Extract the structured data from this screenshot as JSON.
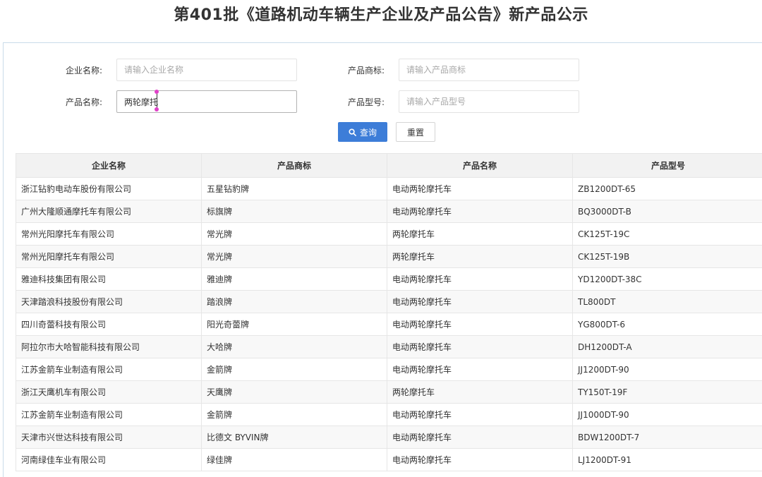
{
  "page": {
    "title": "第401批《道路机动车辆生产企业及产品公告》新产品公示"
  },
  "form": {
    "company_label": "企业名称:",
    "company_placeholder": "请输入企业名称",
    "company_value": "",
    "brand_label": "产品商标:",
    "brand_placeholder": "请输入产品商标",
    "brand_value": "",
    "product_label": "产品名称:",
    "product_placeholder": "",
    "product_value": "两轮摩托",
    "model_label": "产品型号:",
    "model_placeholder": "请输入产品型号",
    "model_value": "",
    "search_label": "查询",
    "reset_label": "重置"
  },
  "table": {
    "headers": [
      "企业名称",
      "产品商标",
      "产品名称",
      "产品型号"
    ],
    "rows": [
      [
        "浙江钻豹电动车股份有限公司",
        "五星钻豹牌",
        "电动两轮摩托车",
        "ZB1200DT-65"
      ],
      [
        "广州大隆顺通摩托车有限公司",
        "标旗牌",
        "电动两轮摩托车",
        "BQ3000DT-B"
      ],
      [
        "常州光阳摩托车有限公司",
        "常光牌",
        "两轮摩托车",
        "CK125T-19C"
      ],
      [
        "常州光阳摩托车有限公司",
        "常光牌",
        "两轮摩托车",
        "CK125T-19B"
      ],
      [
        "雅迪科技集团有限公司",
        "雅迪牌",
        "电动两轮摩托车",
        "YD1200DT-38C"
      ],
      [
        "天津踏浪科技股份有限公司",
        "踏浪牌",
        "电动两轮摩托车",
        "TL800DT"
      ],
      [
        "四川奇蕾科技有限公司",
        "阳光奇蕾牌",
        "电动两轮摩托车",
        "YG800DT-6"
      ],
      [
        "阿拉尔市大哈智能科技有限公司",
        "大哈牌",
        "电动两轮摩托车",
        "DH1200DT-A"
      ],
      [
        "江苏金箭车业制造有限公司",
        "金箭牌",
        "电动两轮摩托车",
        "JJ1200DT-90"
      ],
      [
        "浙江天鹰机车有限公司",
        "天鹰牌",
        "两轮摩托车",
        "TY150T-19F"
      ],
      [
        "江苏金箭车业制造有限公司",
        "金箭牌",
        "电动两轮摩托车",
        "JJ1000DT-90"
      ],
      [
        "天津市兴世达科技有限公司",
        "比德文 BYVIN牌",
        "电动两轮摩托车",
        "BDW1200DT-7"
      ],
      [
        "河南绿佳车业有限公司",
        "绿佳牌",
        "电动两轮摩托车",
        "LJ1200DT-91"
      ]
    ]
  },
  "colors": {
    "accent": "#3d7dd8",
    "header_bg": "#f2f2f2",
    "stripe_bg": "#f8f8f8",
    "border": "#e6e6e6"
  },
  "icons": {
    "search": "search-icon"
  }
}
